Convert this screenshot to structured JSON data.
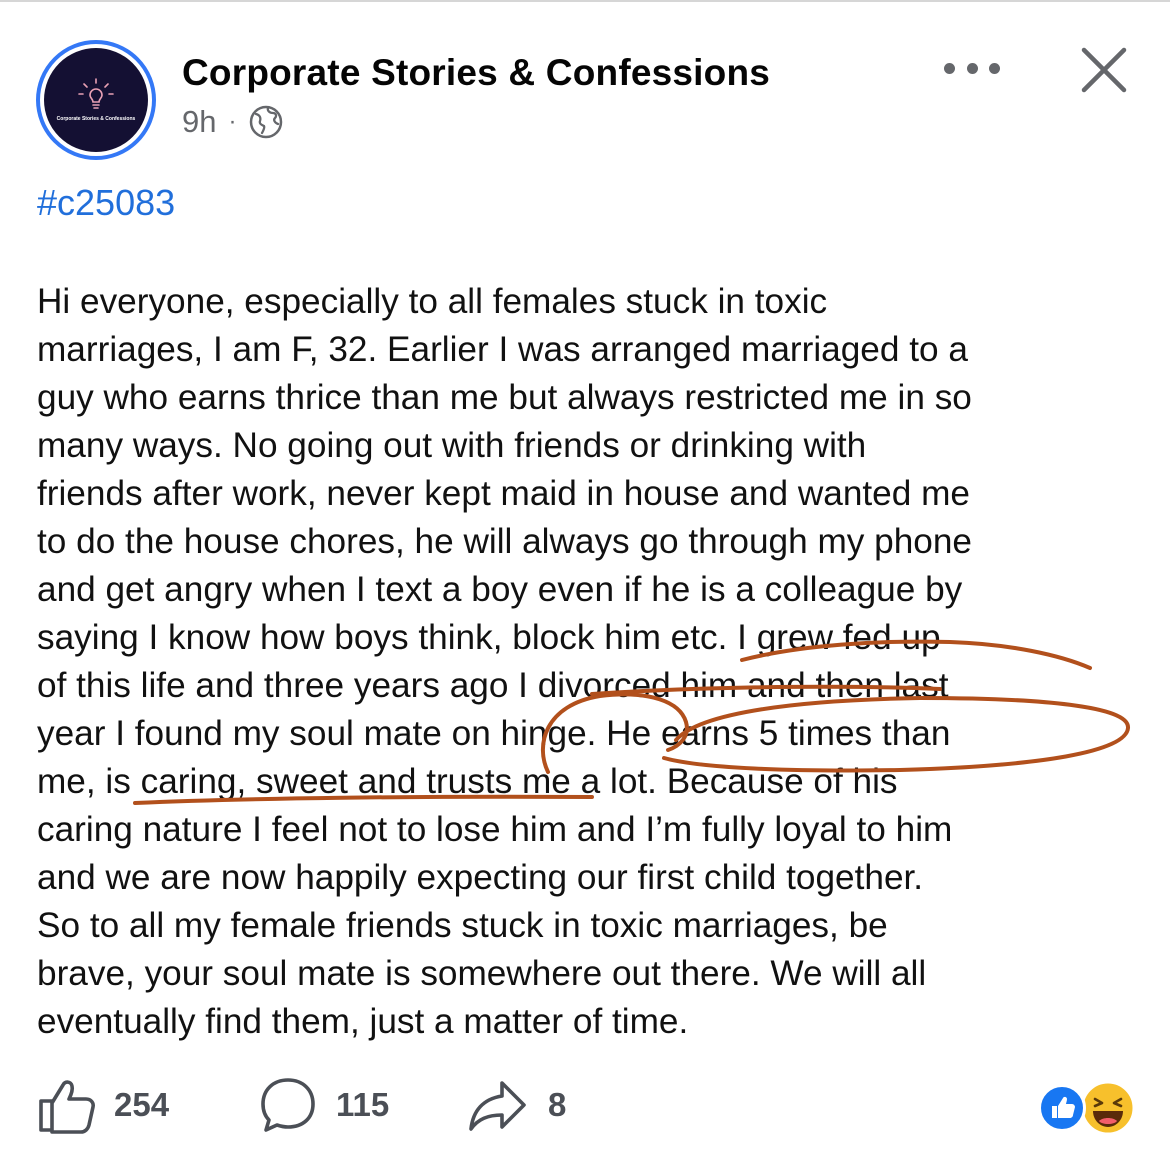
{
  "header": {
    "page_name": "Corporate Stories & Confessions",
    "avatar_text": "Corporate Stories & Confessions",
    "timestamp": "9h",
    "separator": "·",
    "privacy_icon": "globe-icon",
    "more_icon": "more-horizontal-icon",
    "close_icon": "close-icon"
  },
  "post": {
    "hashtag": "#c25083",
    "lines": [
      "Hi everyone, especially to all females stuck in toxic",
      "marriages, I am F, 32. Earlier I was arranged marriaged to a",
      "guy who earns thrice than me but always restricted me in so",
      "many ways. No going out with friends or drinking with",
      "friends  after work, never kept maid in house and wanted me",
      "to do the house chores, he will always go through my phone",
      "and get angry when I text a boy even if he is a colleague by",
      "saying I know how boys think, block him etc. I  grew fed up",
      "of this life and three years ago I divorced him and then last",
      "year I found my soul mate on hinge. He earns 5 times than",
      "me, is caring, sweet and trusts me a lot. Because of his",
      "caring nature I feel not to lose him and I’m fully loyal to him",
      "and we are now happily expecting our first child together.",
      "So to all my female friends stuck in toxic marriages, be",
      "brave, your soul mate is somewhere out there. We will all",
      "eventually find them, just a matter of time."
    ]
  },
  "actions": {
    "like_count": "254",
    "comment_count": "115",
    "share_count": "8",
    "like_icon": "thumbs-up-icon",
    "comment_icon": "comment-bubble-icon",
    "share_icon": "share-arrow-icon"
  },
  "reactions": [
    "like-reaction-icon",
    "haha-reaction-icon"
  ],
  "colors": {
    "link": "#216fdb",
    "annotation": "#b2501c",
    "avatar_ring": "#3478f6",
    "like_blue": "#1877f2"
  }
}
